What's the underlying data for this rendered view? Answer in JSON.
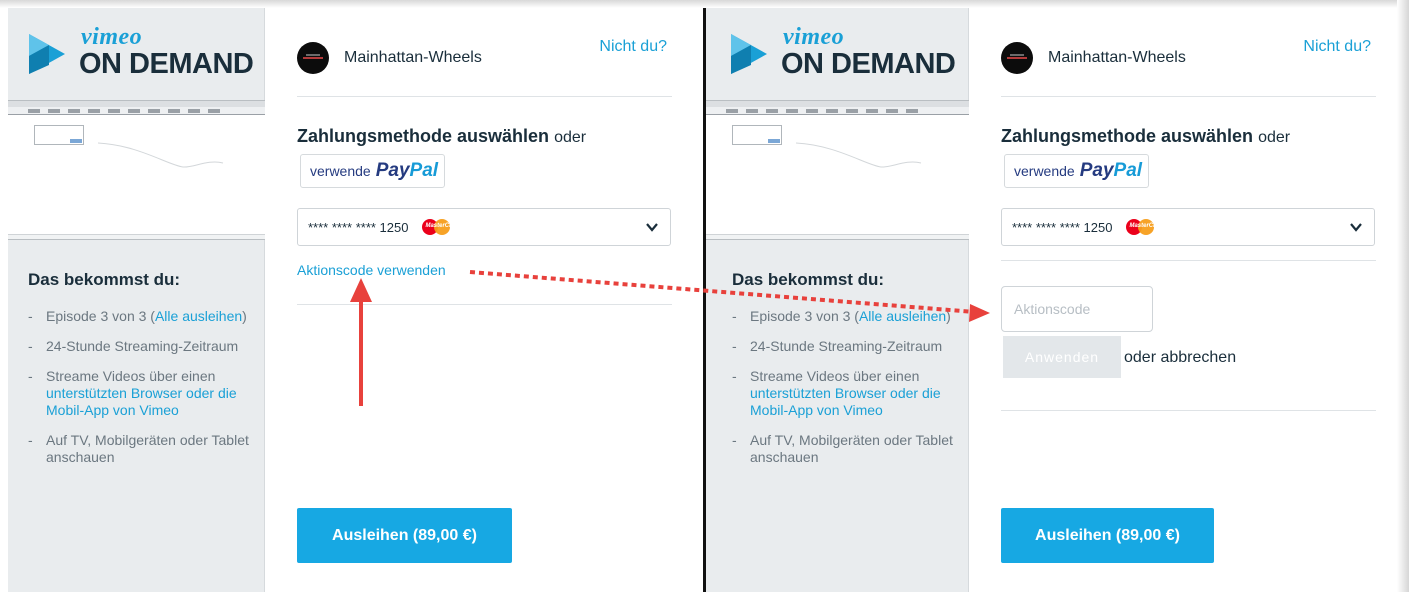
{
  "brand": {
    "vimeo": "vimeo",
    "on_demand": "ON DEMAND",
    "accent": "#1aa0d6",
    "dark": "#1a2e3b"
  },
  "sidebar": {
    "title": "Das bekommst du:",
    "items": [
      {
        "dash": "-",
        "text_1": "Episode 3 von 3 (",
        "link": "Alle ausleihen",
        "text_2": ")"
      },
      {
        "dash": "-",
        "text": "24-Stunde Streaming-Zeitraum"
      },
      {
        "dash": "-",
        "text_1": "Streame Videos über einen ",
        "link": "unterstützten Browser oder die Mobil-App von Vimeo"
      },
      {
        "dash": "-",
        "text": "Auf TV, Mobilgeräten oder Tablet anschauen"
      }
    ]
  },
  "account": {
    "name": "Mainhattan-Wheels",
    "not_you": "Nicht du?"
  },
  "payment": {
    "title": "Zahlungsmethode auswählen",
    "or": "oder",
    "paypal_prefix": "verwende",
    "paypal_a": "Pay",
    "paypal_b": "Pal",
    "card_number": "**** **** **** 1250",
    "card_brand_label": "MasterCard",
    "card_icon": "mastercard-icon"
  },
  "promo": {
    "link_label": "Aktionscode verwenden",
    "input_placeholder": "Aktionscode",
    "input_value": "",
    "apply_label": "Anwenden",
    "or_cancel": "oder abbrechen"
  },
  "rent": {
    "button_label": "Ausleihen (89,00 €)",
    "color": "#17a8e3"
  },
  "annotation": {
    "arrow_color": "#e8413c"
  }
}
